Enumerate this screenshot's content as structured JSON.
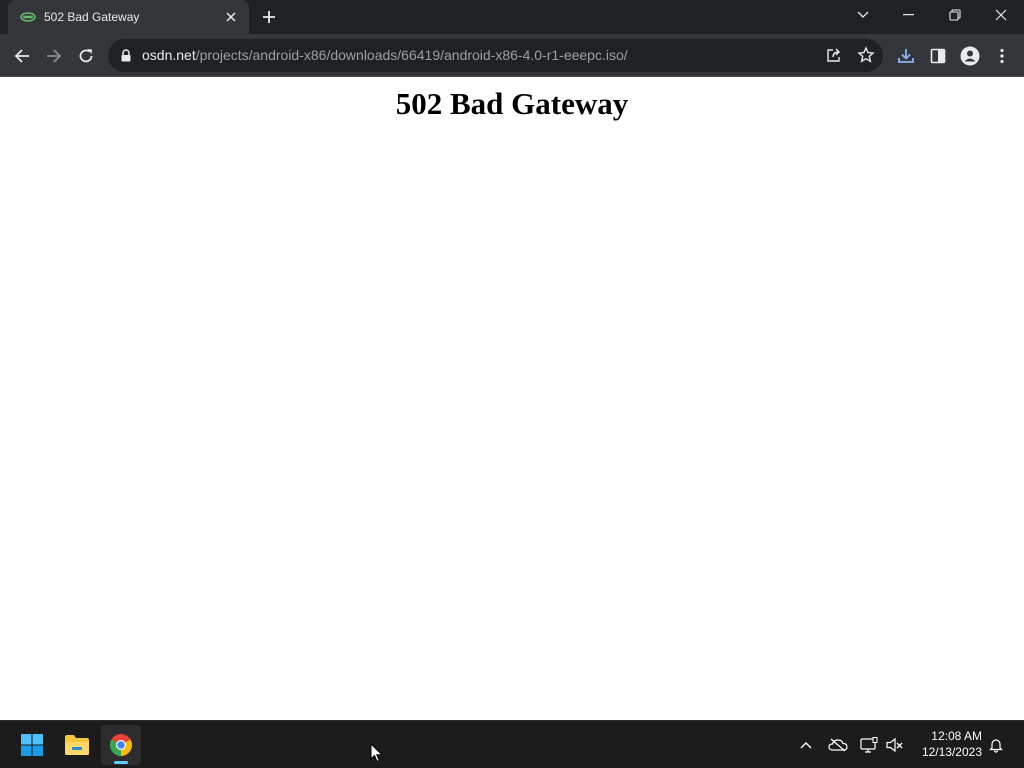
{
  "browser": {
    "tab": {
      "title": "502 Bad Gateway",
      "favicon": "osdn-favicon-icon"
    },
    "address_bar": {
      "host": "osdn.net",
      "path": "/projects/android-x86/downloads/66419/android-x86-4.0-r1-eeepc.iso/"
    }
  },
  "page": {
    "heading": "502 Bad Gateway"
  },
  "taskbar": {
    "apps": [
      "start-icon",
      "file-explorer-icon",
      "chrome-icon"
    ],
    "clock": {
      "time": "12:08 AM",
      "date": "12/13/2023"
    }
  },
  "colors": {
    "titlebar": "#202124",
    "toolbar": "#35363a",
    "omnibox": "#202124",
    "taskbar": "#1c1c1c",
    "accent": "#60cdff"
  }
}
